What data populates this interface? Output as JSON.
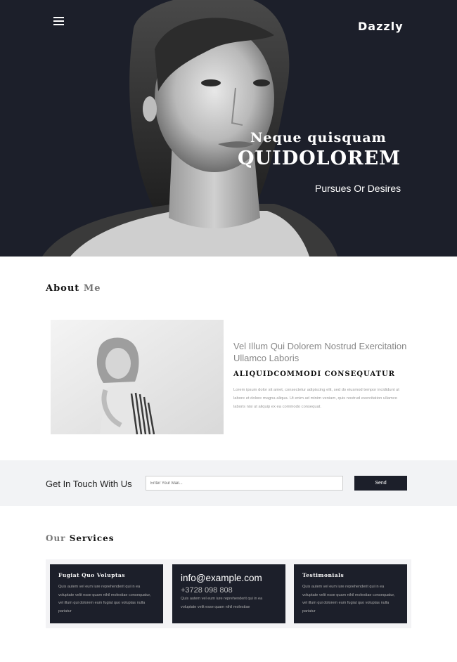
{
  "header": {
    "brand": "Dazzly",
    "menu_icon": "hamburger-menu-icon"
  },
  "hero": {
    "line1": "Neque quisquam",
    "line2": "QUIDOLOREM",
    "subtitle": "Pursues Or Desires"
  },
  "about": {
    "title_main": "About",
    "title_highlight": "Me",
    "heading": "Vel Illum Qui Dolorem Nostrud Exercitation Ullamco Laboris",
    "subheading": "aliquidcommodi consequatur",
    "body": "Lorem ipsum dolor sit amet, consectetur adipiscing elit, sed do eiusmod tempor incididunt ut labore et dolore magna aliqua. Ut enim ad minim veniam, quis nostrud exercitation ullamco laboris nisi ut aliquip ex ea commodo consequat."
  },
  "contact": {
    "label": "Get In Touch With Us",
    "input_placeholder": "Enter Your Mail...",
    "button_label": "Send"
  },
  "services": {
    "title_highlight": "Our",
    "title_main": "Services",
    "cards": [
      {
        "title": "Fugiat Quo Voluptas",
        "text": "Quis autem vel eum iure reprehenderit qui in ea voluptate velit esse quam nihil molestiae consequatur, vel illum qui dolorem eum fugiat quo voluptas nulla pariatur"
      },
      {
        "email": "info@example.com",
        "phone": "+3728 098 808",
        "text": "Quis autem vel eum iure reprehenderit qui in ea voluptate velit esse quam nihil molestiae"
      },
      {
        "title": "Testimonials",
        "text": "Quis autem vel eum iure reprehenderit qui in ea voluptate velit esse quam nihil molestiae consequatur, vel illum qui dolorem eum fugiat quo voluptas nulla pariatur"
      }
    ]
  },
  "colors": {
    "dark": "#1c1f2a",
    "light_band": "#f2f3f5",
    "accent_gray": "#777777"
  }
}
